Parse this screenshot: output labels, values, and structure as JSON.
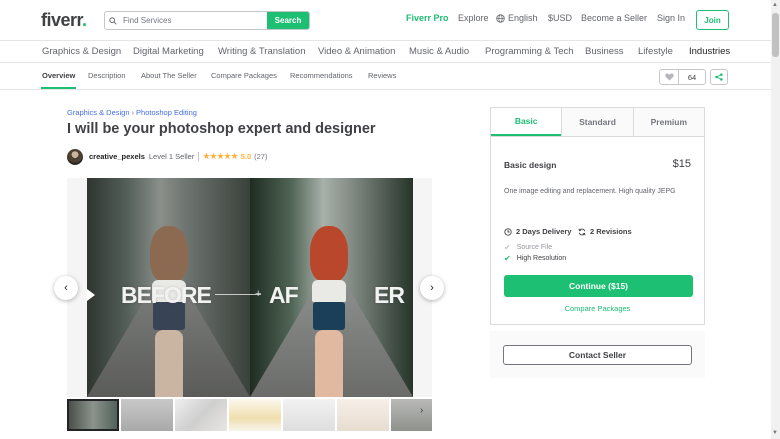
{
  "header": {
    "logo": "fiverr",
    "logo_dot": ".",
    "search_placeholder": "Find Services",
    "search_button": "Search",
    "links": [
      "Fiverr Pro",
      "Explore",
      "English",
      "$USD",
      "Become a Seller",
      "Sign In"
    ],
    "join": "Join"
  },
  "categories": [
    "Graphics & Design",
    "Digital Marketing",
    "Writing & Translation",
    "Video & Animation",
    "Music & Audio",
    "Programming & Tech",
    "Business",
    "Lifestyle",
    "Industries"
  ],
  "subnav": {
    "items": [
      "Overview",
      "Description",
      "About The Seller",
      "Compare Packages",
      "Recommendations",
      "Reviews"
    ],
    "likes": "64"
  },
  "gig": {
    "breadcrumb": [
      "Graphics & Design",
      "Photoshop Editing"
    ],
    "breadcrumb_sep": "›",
    "title": "I will be your photoshop expert and designer",
    "seller": "creative_pexels",
    "level": "Level 1 Seller",
    "stars": "★★★★★",
    "rating": "5.0",
    "reviews": "(27)",
    "image_words": [
      "BEFORE",
      "AF",
      "ER"
    ],
    "prev_glyph": "‹",
    "next_glyph": "›"
  },
  "package": {
    "tabs": [
      "Basic",
      "Standard",
      "Premium"
    ],
    "name": "Basic design",
    "price": "$15",
    "description": "One image editing and replacement. High quality JEPG",
    "delivery": "2 Days Delivery",
    "revisions": "2 Revisions",
    "features": [
      {
        "label": "Source File",
        "included": false
      },
      {
        "label": "High Resolution",
        "included": true
      }
    ],
    "check": "✔",
    "continue": "Continue ($15)",
    "compare": "Compare Packages",
    "contact": "Contact Seller"
  },
  "colors": {
    "brand_green": "#1dbf73",
    "link_blue": "#446ee7",
    "star": "#ffb33e"
  }
}
